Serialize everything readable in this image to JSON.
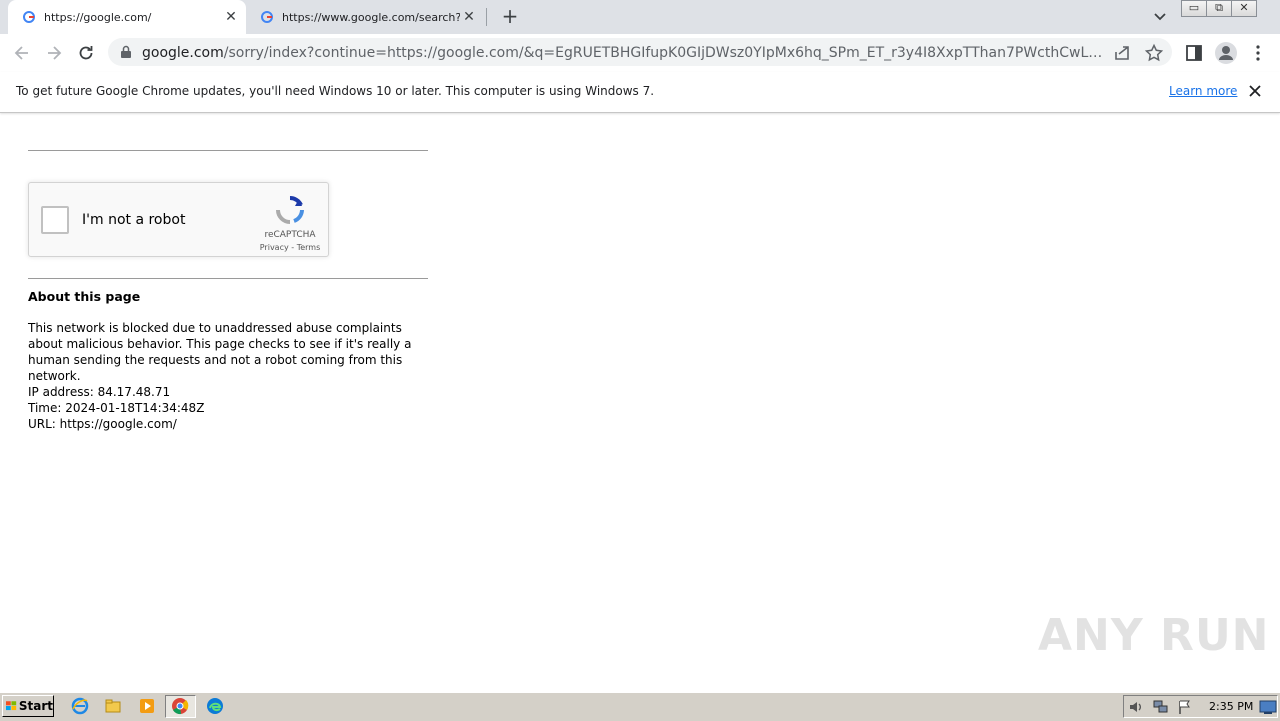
{
  "browser": {
    "tabs": [
      {
        "title": "https://google.com/",
        "close": "✕"
      },
      {
        "title": "https://www.google.com/search?q=",
        "close": "✕"
      }
    ],
    "new_tab": "+",
    "window_buttons": [
      "▭",
      "⧉",
      "✕"
    ],
    "url_host": "google.com",
    "url_rest": "/sorry/index?continue=https://google.com/&q=EgRUETBHGIfupK0GIjDWsz0YIpMx6hq_SPm_ET_r3y4I8XxpTThan7PWcthCwLaharPqpPvjXxX..."
  },
  "infobar": {
    "message": "To get future Google Chrome updates, you'll need Windows 10 or later. This computer is using Windows 7.",
    "learn_more": "Learn more"
  },
  "captcha": {
    "label": "I'm not a robot",
    "brand": "reCAPTCHA",
    "links": "Privacy - Terms"
  },
  "about": {
    "title": "About this page",
    "body": "This network is blocked due to unaddressed abuse complaints about malicious behavior. This page checks to see if it's really a human sending the requests and not a robot coming from this network.",
    "ip": "IP address: 84.17.48.71",
    "time": "Time: 2024-01-18T14:34:48Z",
    "url": "URL: https://google.com/"
  },
  "watermark": "ANY RUN",
  "taskbar": {
    "start": "Start",
    "clock": "2:35 PM"
  },
  "colors": {
    "tabstrip": "#dee1e6",
    "link": "#1a73e8",
    "taskbar": "#d4d0c8"
  }
}
